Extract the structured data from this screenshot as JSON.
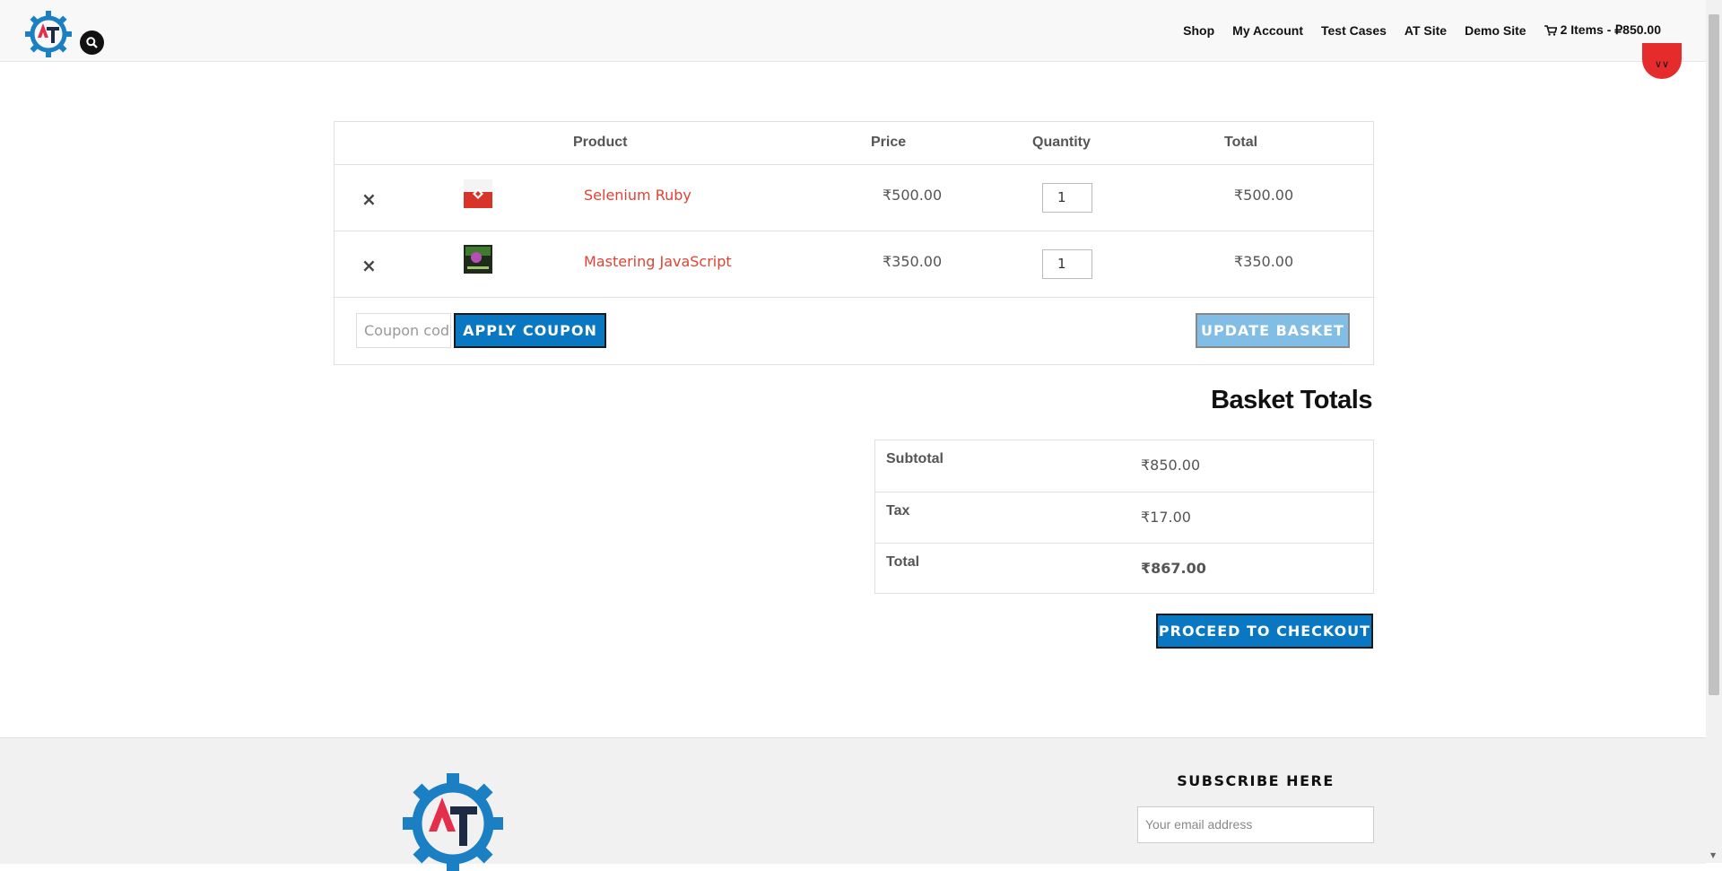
{
  "header": {
    "nav_items": [
      "Shop",
      "My Account",
      "Test Cases",
      "AT Site",
      "Demo Site"
    ],
    "cart_link": "2 Items - ₽850.00"
  },
  "cart": {
    "headers": {
      "product": "Product",
      "price": "Price",
      "quantity": "Quantity",
      "total": "Total"
    },
    "items": [
      {
        "remove": "×",
        "name": "Selenium Ruby",
        "price": "₹500.00",
        "quantity": "1",
        "total": "₹500.00"
      },
      {
        "remove": "×",
        "name": "Mastering JavaScript",
        "price": "₹350.00",
        "quantity": "1",
        "total": "₹350.00"
      }
    ],
    "coupon_placeholder": "Coupon code",
    "apply_coupon_label": "APPLY COUPON",
    "update_basket_label": "UPDATE BASKET"
  },
  "totals": {
    "title": "Basket Totals",
    "subtotal_label": "Subtotal",
    "subtotal_value": "₹850.00",
    "tax_label": "Tax",
    "tax_value": "₹17.00",
    "total_label": "Total",
    "total_value": "₹867.00",
    "checkout_label": "PROCEED TO CHECKOUT"
  },
  "footer": {
    "subscribe_title": "SUBSCRIBE HERE",
    "email_placeholder": "Your email address"
  },
  "colors": {
    "accent_blue": "#0a77c2",
    "product_link_red": "#e04333",
    "scroll_top_red": "#e52b2b"
  }
}
